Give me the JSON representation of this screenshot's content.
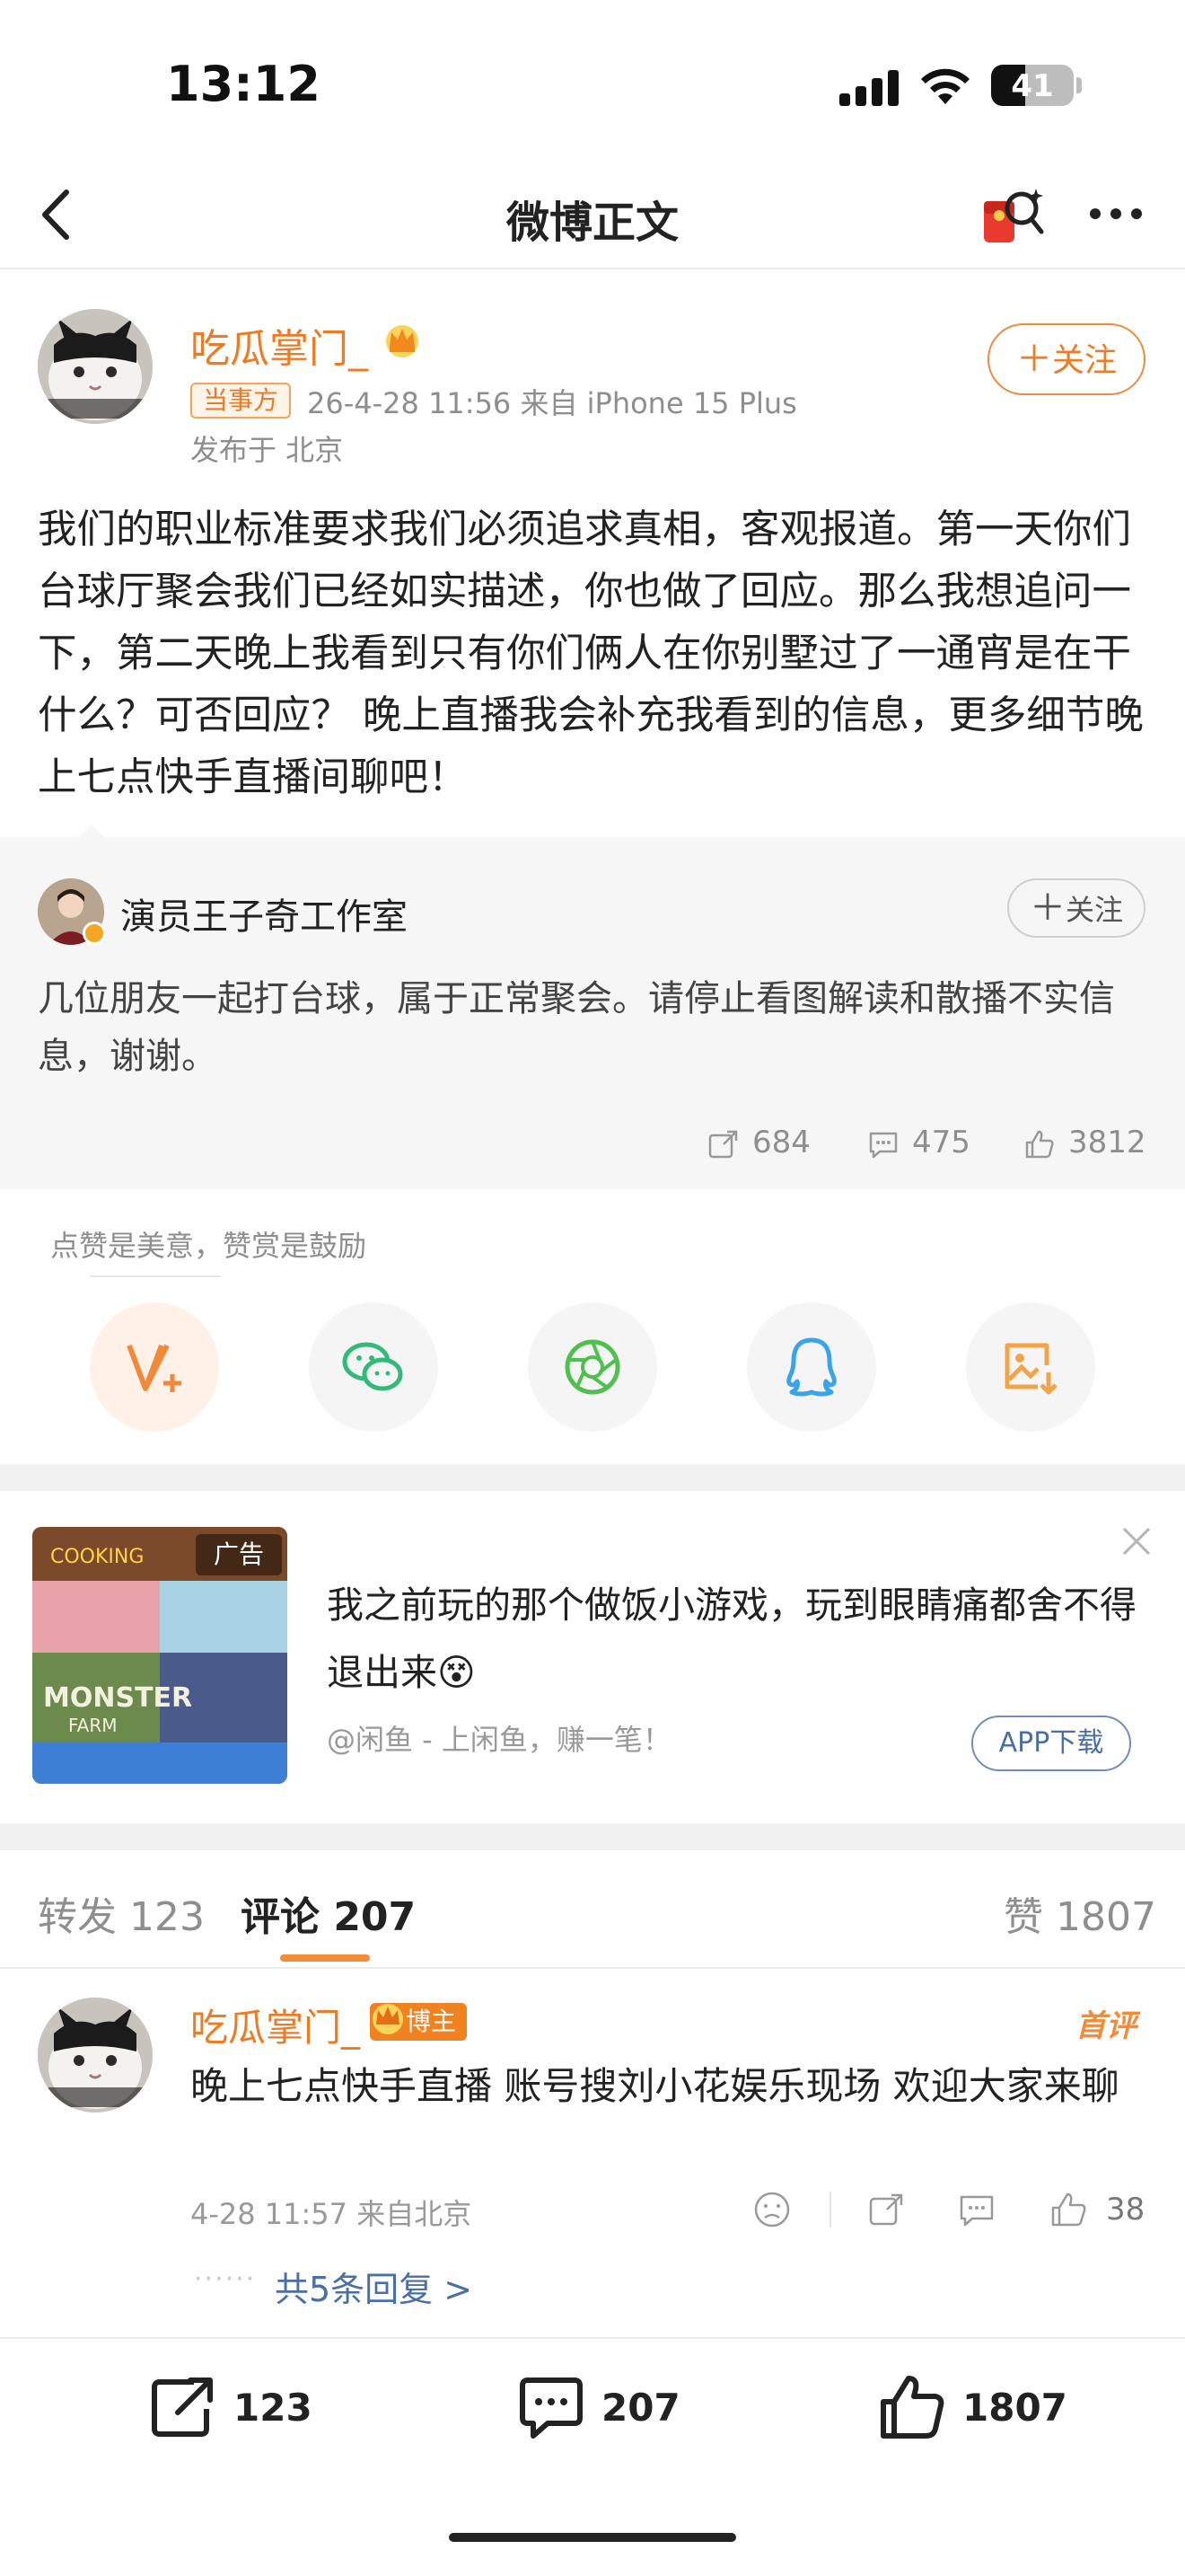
{
  "status": {
    "time": "13:12",
    "battery": "41",
    "battery_level": 0.41
  },
  "nav": {
    "title": "微博正文"
  },
  "post": {
    "author": "吃瓜掌门_",
    "tag": "当事方",
    "meta": "26-4-28 11:56  来自 iPhone 15 Plus",
    "location": "发布于 北京",
    "follow": "关注",
    "body": "我们的职业标准要求我们必须追求真相，客观报道。第一天你们台球厅聚会我们已经如实描述，你也做了回应。那么我想追问一下，第二天晚上我看到只有你们俩人在你别墅过了一通宵是在干什么？可否回应？ 晚上直播我会补充我看到的信息，更多细节晚上七点快手直播间聊吧！"
  },
  "quote": {
    "author": "演员王子奇工作室",
    "follow": "关注",
    "text": "几位朋友一起打台球，属于正常聚会。请停止看图解读和散播不实信息，谢谢。",
    "reposts": "684",
    "comments": "475",
    "likes": "3812"
  },
  "reward": {
    "hint": "点赞是美意，赞赏是鼓励"
  },
  "ad": {
    "tag": "广告",
    "text": "我之前玩的那个做饭小游戏，玩到眼睛痛都舍不得退出来😵",
    "source": "@闲鱼 - 上闲鱼，赚一笔！",
    "download": "APP下载"
  },
  "tabs": {
    "reposts": "转发 123",
    "comments": "评论 207",
    "likes": "赞 1807"
  },
  "comment": {
    "author": "吃瓜掌门_",
    "badge": "博主",
    "first_badge": "首评",
    "text": "晚上七点快手直播 账号搜刘小花娱乐现场 欢迎大家来聊",
    "meta": "4-28 11:57  来自北京",
    "likes": "38",
    "replies": "共5条回复 >"
  },
  "bottom": {
    "reposts": "123",
    "comments": "207",
    "likes": "1807"
  },
  "colors": {
    "accent": "#ee7a24",
    "link": "#4a6fa5"
  }
}
